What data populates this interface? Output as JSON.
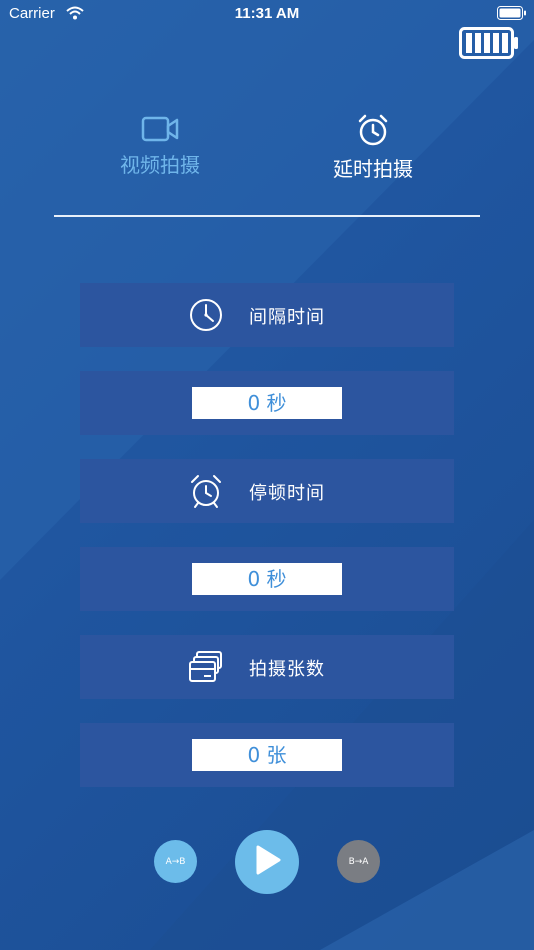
{
  "status_bar": {
    "carrier": "Carrier",
    "time": "11:31 AM"
  },
  "tabs": {
    "video": {
      "label": "视频拍摄",
      "icon": "video-camera-icon",
      "active": false
    },
    "timelapse": {
      "label": "延时拍摄",
      "icon": "alarm-clock-icon",
      "active": true
    }
  },
  "settings": {
    "interval": {
      "title": "间隔时间",
      "icon": "clock-icon",
      "value": "0 秒"
    },
    "pause": {
      "title": "停顿时间",
      "icon": "alarm-clock-icon",
      "value": "0 秒"
    },
    "count": {
      "title": "拍摄张数",
      "icon": "photo-stack-icon",
      "value": "0 张"
    }
  },
  "controls": {
    "a_to_b": "A→B",
    "b_to_a": "B→A",
    "play_icon": "play-icon"
  },
  "colors": {
    "background": "#1f559f",
    "row_background": "#2c559f",
    "accent": "#6cbcea",
    "inactive_tab": "#6fb5ea",
    "value_text": "#3f8fd9",
    "disabled_button": "#7a7d83"
  }
}
